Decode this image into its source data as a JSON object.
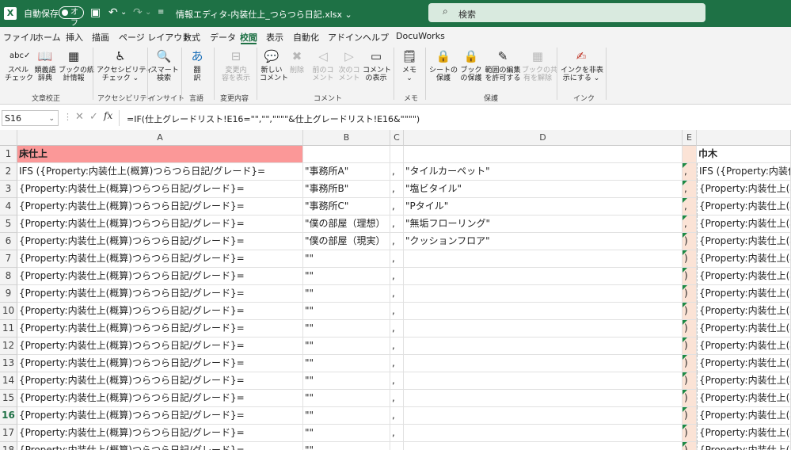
{
  "titlebar": {
    "logo": "X",
    "autosave_label": "自動保存",
    "autosave_state": "オフ",
    "doc_title": "情報エディタ-内装仕上_つらつら日記.xlsx ⌄",
    "search_placeholder": "検索"
  },
  "menu": [
    "ファイル",
    "ホーム",
    "挿入",
    "描画",
    "ページ レイアウト",
    "数式",
    "データ",
    "校閲",
    "表示",
    "自動化",
    "アドイン",
    "ヘルプ",
    "DocuWorks"
  ],
  "active_menu": "校閲",
  "ribbon": {
    "groups": [
      {
        "label": "文章校正",
        "buttons": [
          {
            "icon": "spell-check-icon",
            "glyph": "abc✓",
            "label": "スペル\nチェック"
          },
          {
            "icon": "thesaurus-icon",
            "glyph": "📖",
            "label": "類義語\n辞典"
          },
          {
            "icon": "workbook-stats-icon",
            "glyph": "▦",
            "label": "ブックの統\n計情報"
          }
        ]
      },
      {
        "label": "アクセシビリティ",
        "buttons": [
          {
            "icon": "accessibility-icon",
            "glyph": "♿",
            "label": "アクセシビリティ\nチェック ⌄"
          }
        ]
      },
      {
        "label": "インサイト",
        "buttons": [
          {
            "icon": "smart-lookup-icon",
            "glyph": "🔍",
            "label": "スマート\n検索"
          }
        ]
      },
      {
        "label": "言語",
        "buttons": [
          {
            "icon": "translate-icon",
            "glyph": "あ",
            "label": "翻\n訳"
          }
        ]
      },
      {
        "label": "変更内容",
        "buttons": [
          {
            "icon": "changes-icon",
            "glyph": "⊟",
            "label": "変更内\n容を表示",
            "disabled": true
          }
        ]
      },
      {
        "label": "コメント",
        "buttons": [
          {
            "icon": "new-comment-icon",
            "glyph": "💬",
            "label": "新しい\nコメント"
          },
          {
            "icon": "delete-comment-icon",
            "glyph": "✖",
            "label": "削除",
            "disabled": true
          },
          {
            "icon": "prev-comment-icon",
            "glyph": "◁",
            "label": "前のコ\nメント",
            "disabled": true
          },
          {
            "icon": "next-comment-icon",
            "glyph": "▷",
            "label": "次のコ\nメント",
            "disabled": true
          },
          {
            "icon": "show-comments-icon",
            "glyph": "▭",
            "label": "コメント\nの表示"
          }
        ]
      },
      {
        "label": "メモ",
        "buttons": [
          {
            "icon": "notes-icon",
            "glyph": "🗒",
            "label": "メモ\n⌄"
          }
        ]
      },
      {
        "label": "保護",
        "buttons": [
          {
            "icon": "protect-sheet-icon",
            "glyph": "🔒",
            "label": "シートの\n保護"
          },
          {
            "icon": "protect-workbook-icon",
            "glyph": "🔒",
            "label": "ブック\nの保護"
          },
          {
            "icon": "allow-edit-icon",
            "glyph": "✎",
            "label": "範囲の編集\nを許可する"
          },
          {
            "icon": "unshare-icon",
            "glyph": "▦",
            "label": "ブックの共\n有を解除",
            "disabled": true
          }
        ]
      },
      {
        "label": "インク",
        "buttons": [
          {
            "icon": "hide-ink-icon",
            "glyph": "✍",
            "label": "インクを非表\n示にする ⌄"
          }
        ]
      }
    ]
  },
  "formula_bar": {
    "name_box": "S16",
    "formula": "=IF(仕上グレードリスト!E16=\"\",\"\",\"\"\"\"&仕上グレードリスト!E16&\"\"\"\")"
  },
  "grid": {
    "columns": [
      "A",
      "B",
      "C",
      "D",
      "E",
      ""
    ],
    "selected_row": "16",
    "rows": [
      {
        "n": "1",
        "a": "床仕上",
        "b": "",
        "c": "",
        "d": "",
        "e": "",
        "f": "巾木"
      },
      {
        "n": "2",
        "a": "IFS ({Property:内装仕上(概算)つらつら日記/グレード}=",
        "b": "\"事務所A\"",
        "c": ",",
        "d": "\"タイルカーペット\"",
        "e": ",",
        "f": "IFS ({Property:内装仕上(概算"
      },
      {
        "n": "3",
        "a": "{Property:内装仕上(概算)つらつら日記/グレード}=",
        "b": "\"事務所B\"",
        "c": ",",
        "d": "\"塩ビタイル\"",
        "e": ",",
        "f": "{Property:内装仕上(概算"
      },
      {
        "n": "4",
        "a": "{Property:内装仕上(概算)つらつら日記/グレード}=",
        "b": "\"事務所C\"",
        "c": ",",
        "d": "\"Pタイル\"",
        "e": ",",
        "f": "{Property:内装仕上(概算"
      },
      {
        "n": "5",
        "a": "{Property:内装仕上(概算)つらつら日記/グレード}=",
        "b": "\"僕の部屋（理想）",
        "c": ",",
        "d": "\"無垢フローリング\"",
        "e": ",",
        "f": "{Property:内装仕上(概算"
      },
      {
        "n": "6",
        "a": "{Property:内装仕上(概算)つらつら日記/グレード}=",
        "b": "\"僕の部屋（現実）",
        "c": ",",
        "d": "\"クッションフロア\"",
        "e": ")",
        "f": "{Property:内装仕上(概算"
      },
      {
        "n": "7",
        "a": "{Property:内装仕上(概算)つらつら日記/グレード}=",
        "b": "\"\"",
        "c": ",",
        "d": "",
        "e": ")",
        "f": "{Property:内装仕上(概算"
      },
      {
        "n": "8",
        "a": "{Property:内装仕上(概算)つらつら日記/グレード}=",
        "b": "\"\"",
        "c": ",",
        "d": "",
        "e": ")",
        "f": "{Property:内装仕上(概算"
      },
      {
        "n": "9",
        "a": "{Property:内装仕上(概算)つらつら日記/グレード}=",
        "b": "\"\"",
        "c": ",",
        "d": "",
        "e": ")",
        "f": "{Property:内装仕上(概算"
      },
      {
        "n": "10",
        "a": "{Property:内装仕上(概算)つらつら日記/グレード}=",
        "b": "\"\"",
        "c": ",",
        "d": "",
        "e": ")",
        "f": "{Property:内装仕上(概算"
      },
      {
        "n": "11",
        "a": "{Property:内装仕上(概算)つらつら日記/グレード}=",
        "b": "\"\"",
        "c": ",",
        "d": "",
        "e": ")",
        "f": "{Property:内装仕上(概算"
      },
      {
        "n": "12",
        "a": "{Property:内装仕上(概算)つらつら日記/グレード}=",
        "b": "\"\"",
        "c": ",",
        "d": "",
        "e": ")",
        "f": "{Property:内装仕上(概算"
      },
      {
        "n": "13",
        "a": "{Property:内装仕上(概算)つらつら日記/グレード}=",
        "b": "\"\"",
        "c": ",",
        "d": "",
        "e": ")",
        "f": "{Property:内装仕上(概算"
      },
      {
        "n": "14",
        "a": "{Property:内装仕上(概算)つらつら日記/グレード}=",
        "b": "\"\"",
        "c": ",",
        "d": "",
        "e": ")",
        "f": "{Property:内装仕上(概算"
      },
      {
        "n": "15",
        "a": "{Property:内装仕上(概算)つらつら日記/グレード}=",
        "b": "\"\"",
        "c": ",",
        "d": "",
        "e": ")",
        "f": "{Property:内装仕上(概算"
      },
      {
        "n": "16",
        "a": "{Property:内装仕上(概算)つらつら日記/グレード}=",
        "b": "\"\"",
        "c": ",",
        "d": "",
        "e": ")",
        "f": "{Property:内装仕上(概算"
      },
      {
        "n": "17",
        "a": "{Property:内装仕上(概算)つらつら日記/グレード}=",
        "b": "\"\"",
        "c": ",",
        "d": "",
        "e": ")",
        "f": "{Property:内装仕上(概算"
      },
      {
        "n": "18",
        "a": "{Property:内装仕上(概算)つらつら日記/グレード}=",
        "b": "\"\"",
        "c": ",",
        "d": "",
        "e": ")",
        "f": "{Property:内装仕上(概算"
      }
    ]
  },
  "colors": {
    "brand": "#1e7145",
    "header_pink": "#fb9898",
    "peach": "#fbe3d6"
  }
}
